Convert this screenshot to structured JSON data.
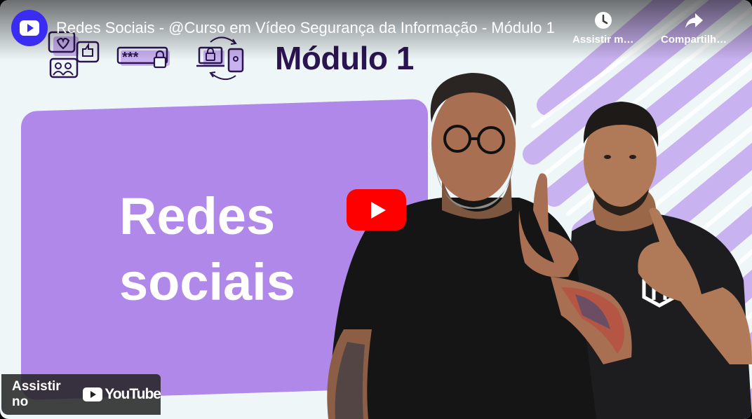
{
  "video": {
    "title": "Redes Sociais - @Curso em Vídeo Segurança da Informação - Módulo 1"
  },
  "actions": {
    "watch_later_label": "Assistir m…",
    "share_label": "Compartilh…"
  },
  "thumbnail": {
    "module_title": "Módulo 1",
    "card_line1": "Redes",
    "card_line2": "sociais",
    "password_mask": "***"
  },
  "footer": {
    "watch_on_label": "Assistir no",
    "youtube_wordmark": "YouTube"
  },
  "colors": {
    "card_purple": "#b088ea",
    "stripe_purple": "#c9b2f0",
    "title_navy": "#2b1551",
    "play_red": "#ff0000",
    "channel_blue": "#3a2cf0"
  },
  "icons": [
    "clock-icon",
    "share-icon",
    "social-media-icon",
    "password-icon",
    "device-lock-icon",
    "youtube-logo-icon",
    "play-icon"
  ]
}
